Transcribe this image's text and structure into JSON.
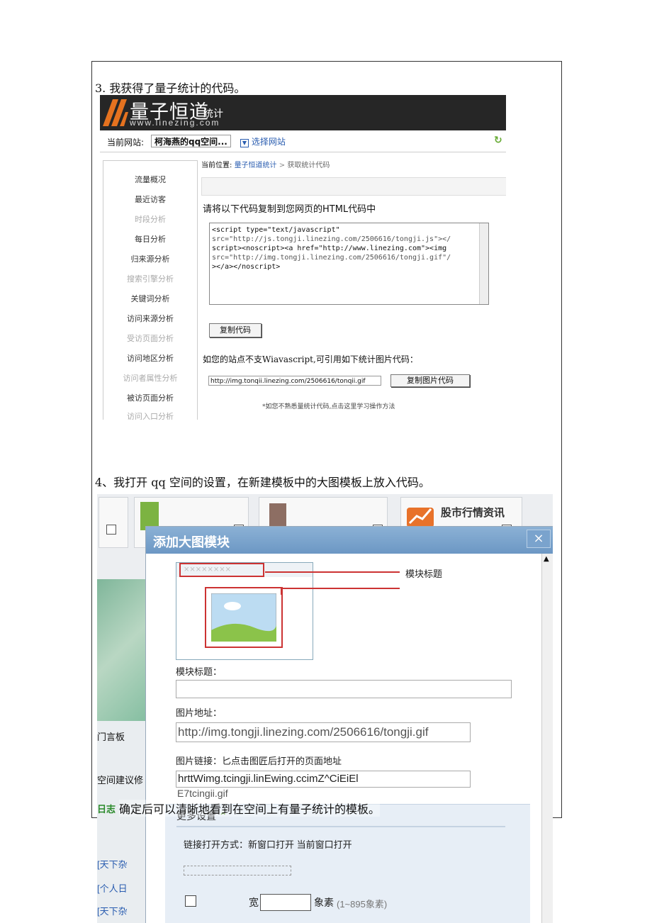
{
  "steps": {
    "step3": "3. 我获得了量子统计的代码。",
    "step4": "4、我打开 qq 空间的设置，在新建模板中的大图模板上放入代码。",
    "step5": "确定后可以清晰地看到在空间上有量子统计的模板。"
  },
  "shot1": {
    "logo_cn": "量子恒道",
    "logo_sub": "统计",
    "logo_url": "www.linezing.com",
    "site_label": "当前网站:",
    "site_value": "柯海燕的qq空间...",
    "choose_site": "选择网站",
    "breadcrumb_a": "当前位置:",
    "breadcrumb_b": "量子恒道统计",
    "breadcrumb_c": "获取统计代码",
    "sidebar": [
      "流量概况",
      "最近访客",
      "时段分析",
      "每日分析",
      "归来源分析",
      "搜索引擎分析",
      "关键词分析",
      "访问来源分析",
      "受访页面分析",
      "访问地区分析",
      "访问者属性分析",
      "被访页面分析",
      "访问入口分析"
    ],
    "instruction": "请将以下代码复制到您网页的HTML代码中",
    "code_line1": "<script type=\"text/javascript\"",
    "code_line2": "src=\"http://js.tongji.linezing.com/2506616/tongji.js\"></",
    "code_line3": "script><noscript><a href=\"http://www.linezing.com\"><img",
    "code_line4": "src=\"http://img.tongji.linezing.com/2506616/tongji.gif\"/",
    "code_line5": "></a></noscript>",
    "copy_code": "复制代码",
    "no_js": "如您的站点不支Wiavascript,可引用如下统计图片代码：",
    "img_url": "http://img.tonqii.linezing.com/2506616/tonqii.gif",
    "copy_img": "复制图片代码",
    "help": "*如您不熟悉量统计代码,点击这里学习操作方法"
  },
  "shot2": {
    "tile_label": "股市行情资讯",
    "dialog_title": "添加大图模块",
    "close": "×",
    "callout1": "模块标题",
    "label_title": "模块标题：",
    "label_img_url": "图片地址：",
    "img_url_value": "http://img.tongji.linezing.com/2506616/tongji.gif",
    "label_img_link": "图片链接：匕点击图匠后打开的页面地址",
    "img_link_value": "hrttWimg.tcingji.linEwing.ccimZ^CiEiEl",
    "img_link_overflow": "E7tcingii.gif",
    "more_settings": "更多设置",
    "link_mode": "链接打开方式：新窗口打开  当前窗口打开",
    "width_label": "宽",
    "width_unit": "象素",
    "width_range": "(1~895象素)",
    "left_items": [
      "门言板",
      "空间建议修",
      "日志",
      "[天下杂",
      "[个人日",
      "[天下杂"
    ]
  }
}
